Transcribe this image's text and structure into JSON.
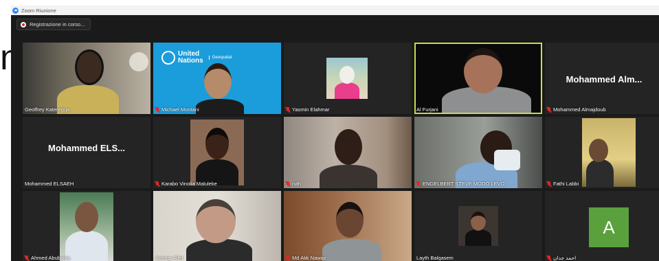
{
  "edge_text": "n",
  "window": {
    "title": "Zoom Riunione",
    "recording_label": "Registrazione in corso..."
  },
  "banner": {
    "line1": "United",
    "line2": "Nations",
    "sub": "Geospatial"
  },
  "participants": [
    {
      "name": "Geoffrey Kateregga",
      "muted": false
    },
    {
      "name": "Michael Montani",
      "muted": true
    },
    {
      "name": "Yasmin Elahmar",
      "muted": true
    },
    {
      "name": "Al Furjani",
      "muted": false,
      "active_speaker": true
    },
    {
      "name": "Mohammed Almajdoub",
      "muted": true,
      "display": "Mohammed  Alm..."
    },
    {
      "name": "Mohammed ELSAEH",
      "muted": false,
      "display": "Mohammed  ELS..."
    },
    {
      "name": "Karabo Vinolia Maluleke",
      "muted": true
    },
    {
      "name": "ruth",
      "muted": true
    },
    {
      "name": "ENGELBERT STEVE MODO LEVO",
      "muted": true
    },
    {
      "name": "Fathi Labbi",
      "muted": true
    },
    {
      "name": "Ahmed Abubahia",
      "muted": true
    },
    {
      "name": "Ammar Allet",
      "muted": false
    },
    {
      "name": "Md Atik Nawaz",
      "muted": true
    },
    {
      "name": "Layth Balqasem",
      "muted": false
    },
    {
      "name": "احمد جدان",
      "muted": true,
      "avatar_letter": "A"
    }
  ],
  "colors": {
    "active_border": "#c9dc4e",
    "muted_icon": "#e02828",
    "avatar_bg": "#5aa03c",
    "un_blue": "#1b9ddb"
  }
}
